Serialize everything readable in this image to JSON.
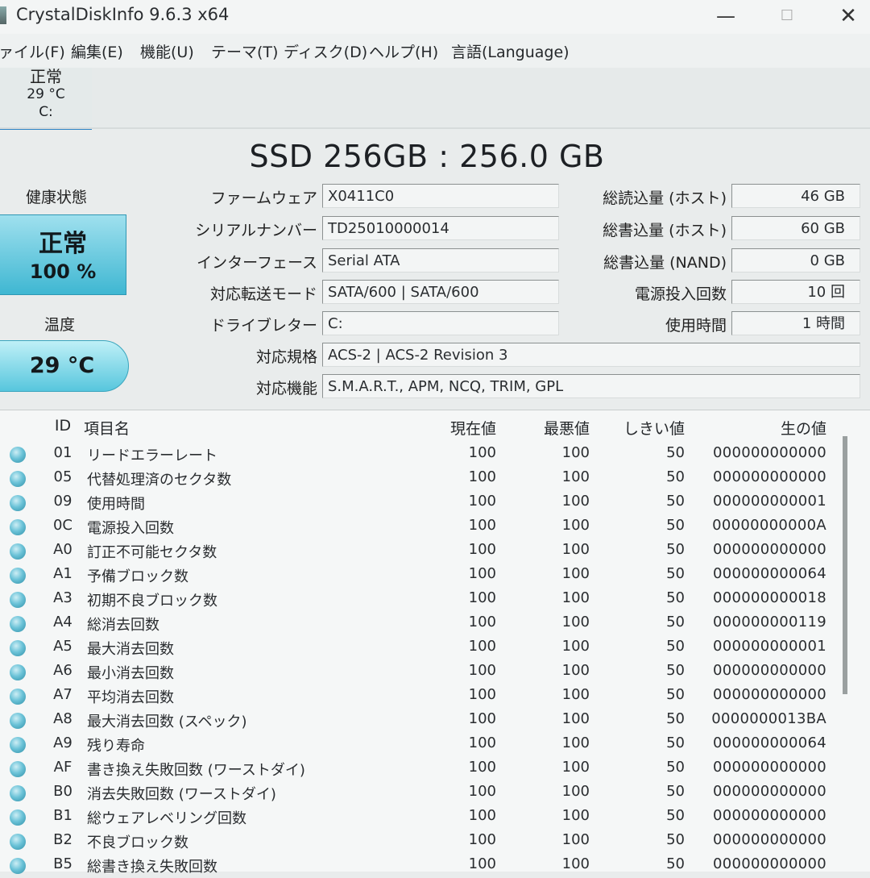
{
  "window": {
    "title": "CrystalDiskInfo 9.6.3 x64",
    "minimize": "—",
    "maximize": "☐",
    "close": "✕"
  },
  "menu": [
    "ァイル(F)",
    "編集(E)",
    "機能(U)",
    "テーマ(T)",
    "ディスク(D)",
    "ヘルプ(H)",
    "言語(Language)"
  ],
  "disk_tab": {
    "status": "正常",
    "temp": "29 °C",
    "drive": "C:"
  },
  "drive_title": "SSD 256GB : 256.0 GB",
  "health": {
    "label": "健康状態",
    "status": "正常",
    "percent": "100 %"
  },
  "temperature": {
    "label": "温度",
    "value": "29 °C"
  },
  "info": {
    "firmware": {
      "label": "ファームウェア",
      "value": "X0411C0"
    },
    "serial": {
      "label": "シリアルナンバー",
      "value": "TD25010000014"
    },
    "interface": {
      "label": "インターフェース",
      "value": "Serial ATA"
    },
    "transfer_mode": {
      "label": "対応転送モード",
      "value": "SATA/600 | SATA/600"
    },
    "drive_letter": {
      "label": "ドライブレター",
      "value": "C:"
    },
    "standard": {
      "label": "対応規格",
      "value": "ACS-2 | ACS-2 Revision 3"
    },
    "features": {
      "label": "対応機能",
      "value": "S.M.A.R.T., APM, NCQ, TRIM, GPL"
    }
  },
  "stats": {
    "host_reads": {
      "label": "総読込量 (ホスト)",
      "value": "46 GB"
    },
    "host_writes": {
      "label": "総書込量 (ホスト)",
      "value": "60 GB"
    },
    "nand_writes": {
      "label": "総書込量 (NAND)",
      "value": "0 GB"
    },
    "power_on_count": {
      "label": "電源投入回数",
      "value": "10 回"
    },
    "power_on_hours": {
      "label": "使用時間",
      "value": "1 時間"
    }
  },
  "smart": {
    "columns": {
      "id": "ID",
      "name": "項目名",
      "current": "現在値",
      "worst": "最悪値",
      "threshold": "しきい値",
      "raw": "生の値"
    },
    "rows": [
      {
        "id": "01",
        "name": "リードエラーレート",
        "current": "100",
        "worst": "100",
        "threshold": "50",
        "raw": "000000000000"
      },
      {
        "id": "05",
        "name": "代替処理済のセクタ数",
        "current": "100",
        "worst": "100",
        "threshold": "50",
        "raw": "000000000000"
      },
      {
        "id": "09",
        "name": "使用時間",
        "current": "100",
        "worst": "100",
        "threshold": "50",
        "raw": "000000000001"
      },
      {
        "id": "0C",
        "name": "電源投入回数",
        "current": "100",
        "worst": "100",
        "threshold": "50",
        "raw": "00000000000A"
      },
      {
        "id": "A0",
        "name": "訂正不可能セクタ数",
        "current": "100",
        "worst": "100",
        "threshold": "50",
        "raw": "000000000000"
      },
      {
        "id": "A1",
        "name": "予備ブロック数",
        "current": "100",
        "worst": "100",
        "threshold": "50",
        "raw": "000000000064"
      },
      {
        "id": "A3",
        "name": "初期不良ブロック数",
        "current": "100",
        "worst": "100",
        "threshold": "50",
        "raw": "000000000018"
      },
      {
        "id": "A4",
        "name": "総消去回数",
        "current": "100",
        "worst": "100",
        "threshold": "50",
        "raw": "000000000119"
      },
      {
        "id": "A5",
        "name": "最大消去回数",
        "current": "100",
        "worst": "100",
        "threshold": "50",
        "raw": "000000000001"
      },
      {
        "id": "A6",
        "name": "最小消去回数",
        "current": "100",
        "worst": "100",
        "threshold": "50",
        "raw": "000000000000"
      },
      {
        "id": "A7",
        "name": "平均消去回数",
        "current": "100",
        "worst": "100",
        "threshold": "50",
        "raw": "000000000000"
      },
      {
        "id": "A8",
        "name": "最大消去回数 (スペック)",
        "current": "100",
        "worst": "100",
        "threshold": "50",
        "raw": "0000000013BA"
      },
      {
        "id": "A9",
        "name": "残り寿命",
        "current": "100",
        "worst": "100",
        "threshold": "50",
        "raw": "000000000064"
      },
      {
        "id": "AF",
        "name": "書き換え失敗回数 (ワーストダイ)",
        "current": "100",
        "worst": "100",
        "threshold": "50",
        "raw": "000000000000"
      },
      {
        "id": "B0",
        "name": "消去失敗回数 (ワーストダイ)",
        "current": "100",
        "worst": "100",
        "threshold": "50",
        "raw": "000000000000"
      },
      {
        "id": "B1",
        "name": "総ウェアレベリング回数",
        "current": "100",
        "worst": "100",
        "threshold": "50",
        "raw": "000000000000"
      },
      {
        "id": "B2",
        "name": "不良ブロック数",
        "current": "100",
        "worst": "100",
        "threshold": "50",
        "raw": "000000000000"
      },
      {
        "id": "B5",
        "name": "総書き換え失敗回数",
        "current": "100",
        "worst": "100",
        "threshold": "50",
        "raw": "000000000000"
      }
    ]
  }
}
